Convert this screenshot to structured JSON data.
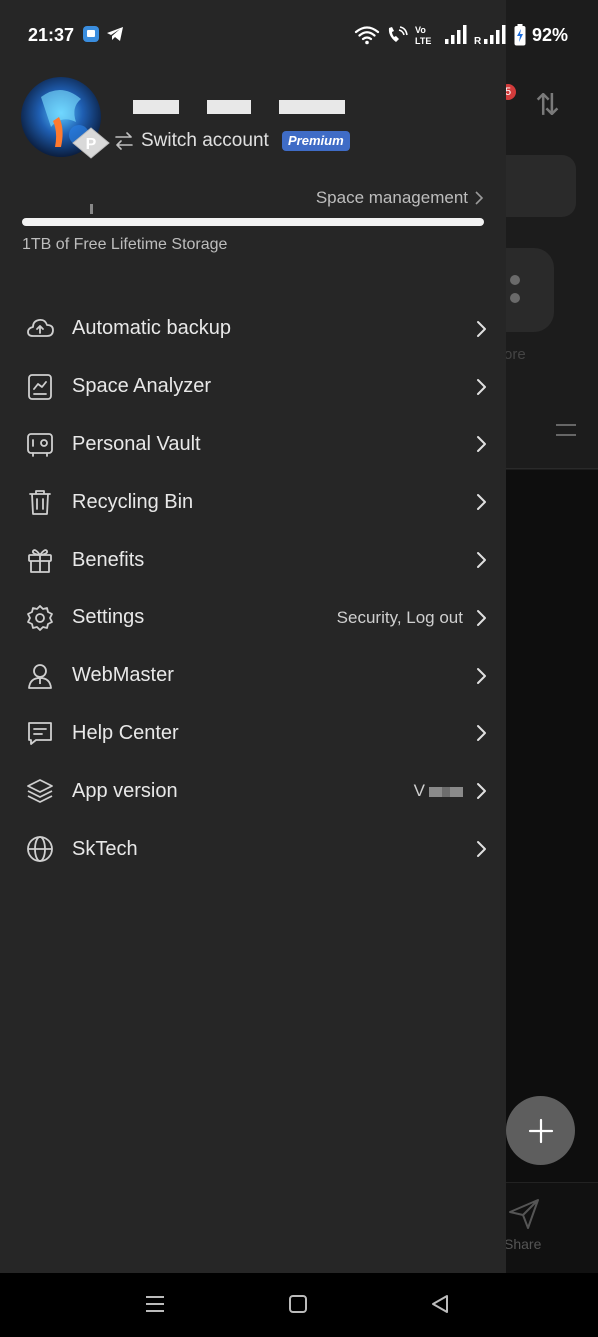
{
  "status_bar": {
    "time": "21:37",
    "battery": "92%"
  },
  "background_app": {
    "badge_count": "5",
    "more_label": "ore",
    "share_label": "Share"
  },
  "account": {
    "switch_label": "Switch account",
    "premium_label": "Premium",
    "avatar_badge": "P"
  },
  "storage": {
    "space_management": "Space management",
    "label": "1TB of Free Lifetime Storage",
    "used_fraction": 0.0
  },
  "menu": [
    {
      "label": "Automatic backup",
      "icon": "cloud-upload-icon",
      "detail": ""
    },
    {
      "label": "Space Analyzer",
      "icon": "analytics-chart-icon",
      "detail": ""
    },
    {
      "label": "Personal Vault",
      "icon": "vault-safe-icon",
      "detail": ""
    },
    {
      "label": "Recycling Bin",
      "icon": "trash-bin-icon",
      "detail": ""
    },
    {
      "label": "Benefits",
      "icon": "gift-icon",
      "detail": ""
    },
    {
      "label": "Settings",
      "icon": "gear-icon",
      "detail": "Security, Log out"
    },
    {
      "label": "WebMaster",
      "icon": "person-icon",
      "detail": ""
    },
    {
      "label": "Help Center",
      "icon": "chat-message-icon",
      "detail": ""
    },
    {
      "label": "App version",
      "icon": "layers-icon",
      "detail": "V"
    },
    {
      "label": "SkTech",
      "icon": "globe-icon",
      "detail": ""
    }
  ],
  "colors": {
    "drawer_bg": "#262626",
    "premium_badge": "#3f6cc6",
    "text_primary": "#e8e8e8"
  }
}
